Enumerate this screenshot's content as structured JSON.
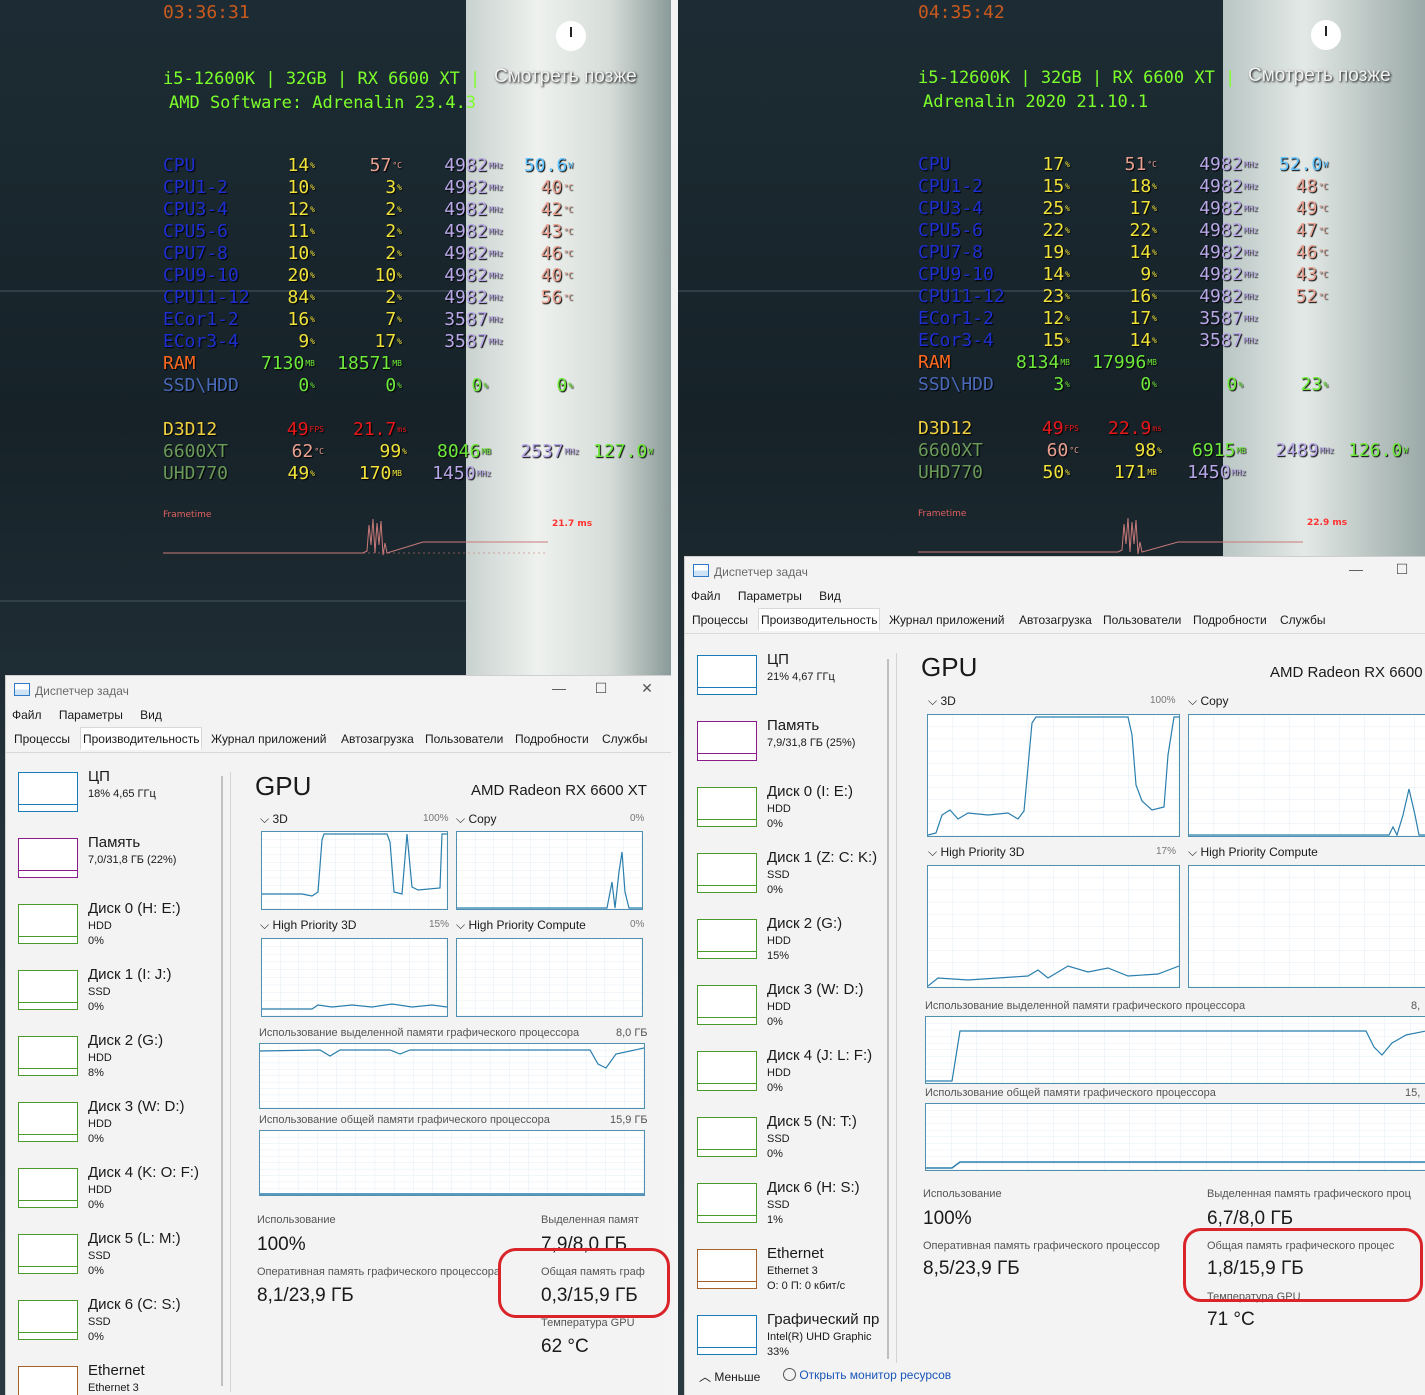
{
  "left": {
    "clock": "03:36:31",
    "watch_later": "Смотреть позже",
    "specs_line1": "i5-12600K | 32GB | RX 6600 XT |",
    "specs_line2": "AMD Software: Adrenalin 23.4.3",
    "cpu_rows": [
      {
        "name": "CPU",
        "v1": "14",
        "u1": "%",
        "v2": "57",
        "u2": "°C",
        "v3": "4982",
        "u3": "MHz",
        "v4": "50.6",
        "u4": "W"
      },
      {
        "name": "CPU1-2",
        "v1": "10",
        "u1": "%",
        "v2": "3",
        "u2": "%",
        "v3": "4982",
        "u3": "MHz",
        "v4": "40",
        "u4": "°C"
      },
      {
        "name": "CPU3-4",
        "v1": "12",
        "u1": "%",
        "v2": "2",
        "u2": "%",
        "v3": "4982",
        "u3": "MHz",
        "v4": "42",
        "u4": "°C"
      },
      {
        "name": "CPU5-6",
        "v1": "11",
        "u1": "%",
        "v2": "2",
        "u2": "%",
        "v3": "4982",
        "u3": "MHz",
        "v4": "43",
        "u4": "°C"
      },
      {
        "name": "CPU7-8",
        "v1": "10",
        "u1": "%",
        "v2": "2",
        "u2": "%",
        "v3": "4982",
        "u3": "MHz",
        "v4": "46",
        "u4": "°C"
      },
      {
        "name": "CPU9-10",
        "v1": "20",
        "u1": "%",
        "v2": "10",
        "u2": "%",
        "v3": "4982",
        "u3": "MHz",
        "v4": "40",
        "u4": "°C"
      },
      {
        "name": "CPU11-12",
        "v1": "84",
        "u1": "%",
        "v2": "2",
        "u2": "%",
        "v3": "4982",
        "u3": "MHz",
        "v4": "56",
        "u4": "°C"
      },
      {
        "name": "ECor1-2",
        "v1": "16",
        "u1": "%",
        "v2": "7",
        "u2": "%",
        "v3": "3587",
        "u3": "MHz",
        "v4": "",
        "u4": ""
      },
      {
        "name": "ECor3-4",
        "v1": "9",
        "u1": "%",
        "v2": "17",
        "u2": "%",
        "v3": "3587",
        "u3": "MHz",
        "v4": "",
        "u4": ""
      }
    ],
    "ram": {
      "name": "RAM",
      "v1": "7130",
      "u1": "MB",
      "v2": "18571",
      "u2": "MB"
    },
    "ssd": {
      "name": "SSD\\HDD",
      "v1": "0",
      "u1": "%",
      "v2": "0",
      "u2": "%",
      "v3": "0",
      "u3": "%",
      "v4": "0",
      "u4": "%"
    },
    "d3d": {
      "name": "D3D12",
      "fps": "49",
      "fps_u": "FPS",
      "ms": "21.7",
      "ms_u": "ms"
    },
    "gpu1": {
      "name": "6600XT",
      "v1": "62",
      "u1": "°C",
      "v2": "99",
      "u2": "%",
      "v3": "8046",
      "u3": "MB",
      "v4": "2537",
      "u4": "MHz",
      "v5": "127.0",
      "u5": "W"
    },
    "gpu2": {
      "name": "UHD770",
      "v1": "49",
      "u1": "%",
      "v2": "170",
      "u2": "MB",
      "v3": "1450",
      "u3": "MHz"
    },
    "frametime_label": "Frametime",
    "frametime_val": "21.7 ms",
    "tm": {
      "title": "Диспетчер задач",
      "menu": [
        "Файл",
        "Параметры",
        "Вид"
      ],
      "tabs": [
        "Процессы",
        "Производительность",
        "Журнал приложений",
        "Автозагрузка",
        "Пользователи",
        "Подробности",
        "Службы"
      ],
      "sidebar": [
        {
          "name": "ЦП",
          "sub1": "18% 4,65 ГГц",
          "sub2": ""
        },
        {
          "name": "Память",
          "sub1": "7,0/31,8 ГБ (22%)",
          "sub2": ""
        },
        {
          "name": "Диск 0 (H: E:)",
          "sub1": "HDD",
          "sub2": "0%"
        },
        {
          "name": "Диск 1 (I: J:)",
          "sub1": "SSD",
          "sub2": "0%"
        },
        {
          "name": "Диск 2 (G:)",
          "sub1": "HDD",
          "sub2": "8%"
        },
        {
          "name": "Диск 3 (W: D:)",
          "sub1": "HDD",
          "sub2": "0%"
        },
        {
          "name": "Диск 4 (K: O: F:)",
          "sub1": "HDD",
          "sub2": "0%"
        },
        {
          "name": "Диск 5 (L: M:)",
          "sub1": "SSD",
          "sub2": "0%"
        },
        {
          "name": "Диск 6 (C: S:)",
          "sub1": "SSD",
          "sub2": "0%"
        },
        {
          "name": "Ethernet",
          "sub1": "Ethernet 3",
          "sub2": ""
        }
      ],
      "gpu_title": "GPU",
      "gpu_model": "AMD Radeon RX 6600 XT",
      "engines": [
        {
          "label": "3D",
          "pct": "100%"
        },
        {
          "label": "Copy",
          "pct": "0%"
        },
        {
          "label": "High Priority 3D",
          "pct": "15%"
        },
        {
          "label": "High Priority Compute",
          "pct": "0%"
        }
      ],
      "dedicated_label": "Использование выделенной памяти графического процессора",
      "dedicated_max": "8,0 ГБ",
      "shared_label": "Использование общей памяти графического процессора",
      "shared_max": "15,9 ГБ",
      "usage_cap": "Использование",
      "usage_val": "100%",
      "ded_cap": "Выделенная памят",
      "ded_val": "7,9/8,0 ГБ",
      "ram_cap": "Оперативная память графического процессора",
      "ram_val": "8,1/23,9 ГБ",
      "shared_cap": "Общая память граф",
      "shared_val": "0,3/15,9 ГБ",
      "temp_cap": "Температура GPU",
      "temp_val": "62 °C"
    }
  },
  "right": {
    "clock": "04:35:42",
    "watch_later": "Смотреть позже",
    "specs_line1": "i5-12600K | 32GB | RX 6600 XT |",
    "specs_line2": "Adrenalin 2020 21.10.1",
    "cpu_rows": [
      {
        "name": "CPU",
        "v1": "17",
        "u1": "%",
        "v2": "51",
        "u2": "°C",
        "v3": "4982",
        "u3": "MHz",
        "v4": "52.0",
        "u4": "W"
      },
      {
        "name": "CPU1-2",
        "v1": "15",
        "u1": "%",
        "v2": "18",
        "u2": "%",
        "v3": "4982",
        "u3": "MHz",
        "v4": "48",
        "u4": "°C"
      },
      {
        "name": "CPU3-4",
        "v1": "25",
        "u1": "%",
        "v2": "17",
        "u2": "%",
        "v3": "4982",
        "u3": "MHz",
        "v4": "49",
        "u4": "°C"
      },
      {
        "name": "CPU5-6",
        "v1": "22",
        "u1": "%",
        "v2": "22",
        "u2": "%",
        "v3": "4982",
        "u3": "MHz",
        "v4": "47",
        "u4": "°C"
      },
      {
        "name": "CPU7-8",
        "v1": "19",
        "u1": "%",
        "v2": "14",
        "u2": "%",
        "v3": "4982",
        "u3": "MHz",
        "v4": "46",
        "u4": "°C"
      },
      {
        "name": "CPU9-10",
        "v1": "14",
        "u1": "%",
        "v2": "9",
        "u2": "%",
        "v3": "4982",
        "u3": "MHz",
        "v4": "43",
        "u4": "°C"
      },
      {
        "name": "CPU11-12",
        "v1": "23",
        "u1": "%",
        "v2": "16",
        "u2": "%",
        "v3": "4982",
        "u3": "MHz",
        "v4": "52",
        "u4": "°C"
      },
      {
        "name": "ECor1-2",
        "v1": "12",
        "u1": "%",
        "v2": "17",
        "u2": "%",
        "v3": "3587",
        "u3": "MHz",
        "v4": "",
        "u4": ""
      },
      {
        "name": "ECor3-4",
        "v1": "15",
        "u1": "%",
        "v2": "14",
        "u2": "%",
        "v3": "3587",
        "u3": "MHz",
        "v4": "",
        "u4": ""
      }
    ],
    "ram": {
      "name": "RAM",
      "v1": "8134",
      "u1": "MB",
      "v2": "17996",
      "u2": "MB"
    },
    "ssd": {
      "name": "SSD\\HDD",
      "v1": "3",
      "u1": "%",
      "v2": "0",
      "u2": "%",
      "v3": "0",
      "u3": "%",
      "v4": "23",
      "u4": "%"
    },
    "d3d": {
      "name": "D3D12",
      "fps": "49",
      "fps_u": "FPS",
      "ms": "22.9",
      "ms_u": "ms"
    },
    "gpu1": {
      "name": "6600XT",
      "v1": "60",
      "u1": "°C",
      "v2": "98",
      "u2": "%",
      "v3": "6915",
      "u3": "MB",
      "v4": "2489",
      "u4": "MHz",
      "v5": "126.0",
      "u5": "W"
    },
    "gpu2": {
      "name": "UHD770",
      "v1": "50",
      "u1": "%",
      "v2": "171",
      "u2": "MB",
      "v3": "1450",
      "u3": "MHz"
    },
    "frametime_label": "Frametime",
    "frametime_val": "22.9 ms",
    "tm": {
      "title": "Диспетчер задач",
      "menu": [
        "Файл",
        "Параметры",
        "Вид"
      ],
      "tabs": [
        "Процессы",
        "Производительность",
        "Журнал приложений",
        "Автозагрузка",
        "Пользователи",
        "Подробности",
        "Службы"
      ],
      "sidebar": [
        {
          "name": "ЦП",
          "sub1": "21% 4,67 ГГц",
          "sub2": ""
        },
        {
          "name": "Память",
          "sub1": "7,9/31,8 ГБ (25%)",
          "sub2": ""
        },
        {
          "name": "Диск 0 (I: E:)",
          "sub1": "HDD",
          "sub2": "0%"
        },
        {
          "name": "Диск 1 (Z: C: K:)",
          "sub1": "SSD",
          "sub2": "0%"
        },
        {
          "name": "Диск 2 (G:)",
          "sub1": "HDD",
          "sub2": "15%"
        },
        {
          "name": "Диск 3 (W: D:)",
          "sub1": "HDD",
          "sub2": "0%"
        },
        {
          "name": "Диск 4 (J: L: F:)",
          "sub1": "HDD",
          "sub2": "0%"
        },
        {
          "name": "Диск 5 (N: T:)",
          "sub1": "SSD",
          "sub2": "0%"
        },
        {
          "name": "Диск 6 (H: S:)",
          "sub1": "SSD",
          "sub2": "1%"
        },
        {
          "name": "Ethernet",
          "sub1": "Ethernet 3",
          "sub2": "О: 0 П: 0 кбит/с"
        },
        {
          "name": "Графический пр",
          "sub1": "Intel(R) UHD Graphic",
          "sub2": "33%"
        }
      ],
      "gpu_title": "GPU",
      "gpu_model": "AMD Radeon RX 6600",
      "engines": [
        {
          "label": "3D",
          "pct": "100%"
        },
        {
          "label": "Copy",
          "pct": ""
        },
        {
          "label": "High Priority 3D",
          "pct": "17%"
        },
        {
          "label": "High Priority Compute",
          "pct": ""
        }
      ],
      "dedicated_label": "Использование выделенной памяти графического процессора",
      "dedicated_max": "8,",
      "shared_label": "Использование общей памяти графического процессора",
      "shared_max": "15,",
      "usage_cap": "Использование",
      "usage_val": "100%",
      "ded_cap": "Выделенная память графического проц",
      "ded_val": "6,7/8,0 ГБ",
      "ram_cap": "Оперативная память графического процессор",
      "ram_val": "8,5/23,9 ГБ",
      "shared_cap": "Общая память графического процес",
      "shared_val": "1,8/15,9 ГБ",
      "temp_cap": "Температура GPU",
      "temp_val": "71 °C",
      "less_label": "Меньше",
      "resmon_label": "Открыть монитор ресурсов"
    }
  },
  "colors": {
    "cpu_name": "#1e2fd0",
    "cpu_pct": "#f0e23a",
    "cpu_temp": "#e8a090",
    "mhz": "#b8a8e8",
    "power": "#62c3ff",
    "ram": "#ff6a20",
    "ssd": "#4a6ab8",
    "green": "#6ee83a",
    "d3d": "#f0d040",
    "fps": "#e8181a",
    "gpu_name": "#6a9a5a",
    "highlight": "#d9242a"
  }
}
